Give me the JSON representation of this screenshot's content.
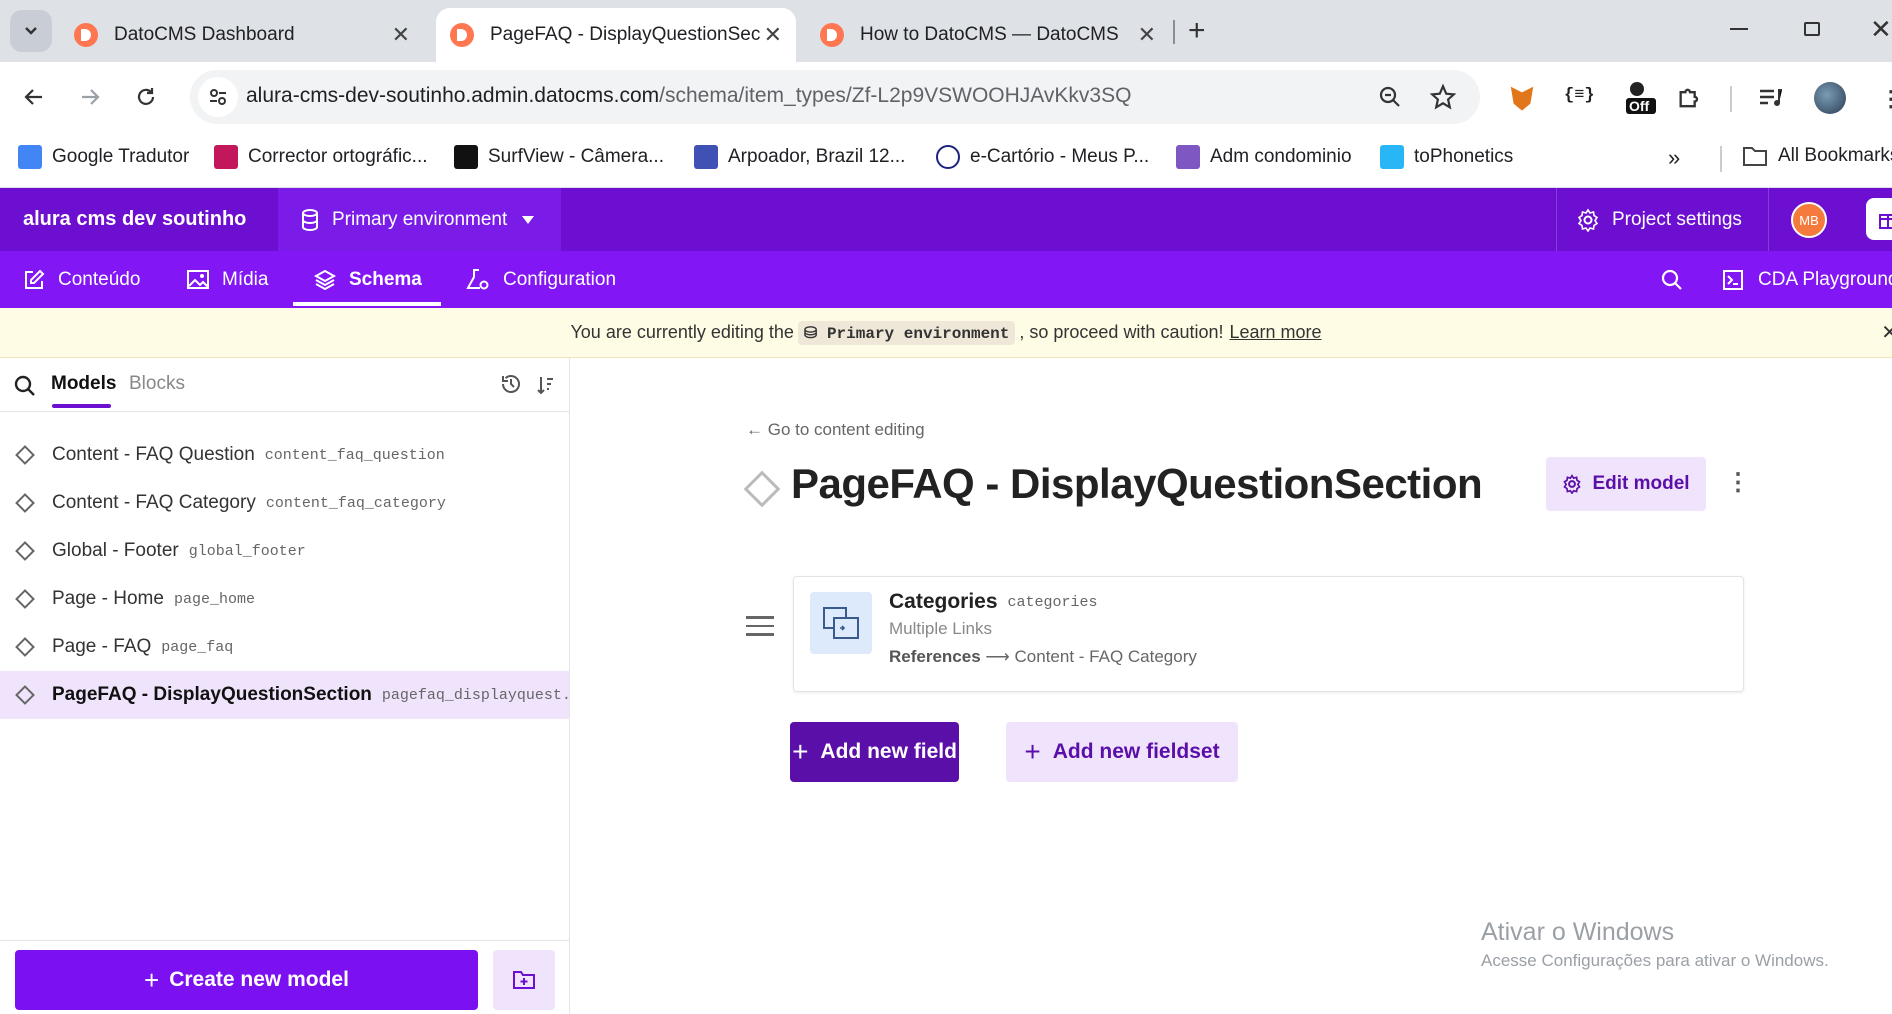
{
  "browser": {
    "tabs": [
      {
        "title": "DatoCMS Dashboard",
        "active": false
      },
      {
        "title": "PageFAQ - DisplayQuestionSect",
        "active": true
      },
      {
        "title": "How to DatoCMS — DatoCMS",
        "active": false
      }
    ],
    "url_domain": "alura-cms-dev-soutinho.admin.datocms.com",
    "url_path": "/schema/item_types/Zf-L2p9VSWOOHJAvKkv3SQ",
    "extension_badge": "Off",
    "bookmarks": [
      {
        "label": "Google Tradutor"
      },
      {
        "label": "Corrector ortográfic..."
      },
      {
        "label": "SurfView - Câmera..."
      },
      {
        "label": "Arpoador, Brazil 12..."
      },
      {
        "label": "e-Cartório - Meus P..."
      },
      {
        "label": "Adm condominio"
      },
      {
        "label": "toPhonetics"
      }
    ],
    "all_bookmarks": "All Bookmarks"
  },
  "header": {
    "project_name": "alura cms dev soutinho",
    "environment": "Primary environment",
    "project_settings": "Project settings",
    "avatar_initials": "MB"
  },
  "nav": {
    "items": [
      {
        "label": "Conteúdo"
      },
      {
        "label": "Mídia"
      },
      {
        "label": "Schema"
      },
      {
        "label": "Configuration"
      }
    ],
    "cda_playground": "CDA Playground"
  },
  "warning": {
    "prefix": "You are currently editing the",
    "env": "Primary environment",
    "suffix": ", so proceed with caution!",
    "link": "Learn more"
  },
  "sidebar": {
    "tabs": [
      {
        "label": "Models"
      },
      {
        "label": "Blocks"
      }
    ],
    "models": [
      {
        "name": "Content - FAQ Question",
        "api": "content_faq_question"
      },
      {
        "name": "Content - FAQ Category",
        "api": "content_faq_category"
      },
      {
        "name": "Global - Footer",
        "api": "global_footer"
      },
      {
        "name": "Page - Home",
        "api": "page_home"
      },
      {
        "name": "Page - FAQ",
        "api": "page_faq"
      },
      {
        "name": "PageFAQ - DisplayQuestionSection",
        "api": "pagefaq_displayquest..."
      }
    ],
    "create_button": "Create new model"
  },
  "main": {
    "back_link": "← Go to content editing",
    "model_title": "PageFAQ - DisplayQuestionSection",
    "edit_model": "Edit model",
    "fields": [
      {
        "name": "Categories",
        "api": "categories",
        "type": "Multiple Links",
        "ref_label": "References",
        "ref_arrow": "⟶",
        "ref_target": "Content - FAQ Category"
      }
    ],
    "add_field": "Add new field",
    "add_fieldset": "Add new fieldset"
  },
  "watermark": {
    "title": "Ativar o Windows",
    "subtitle": "Acesse Configurações para ativar o Windows."
  }
}
